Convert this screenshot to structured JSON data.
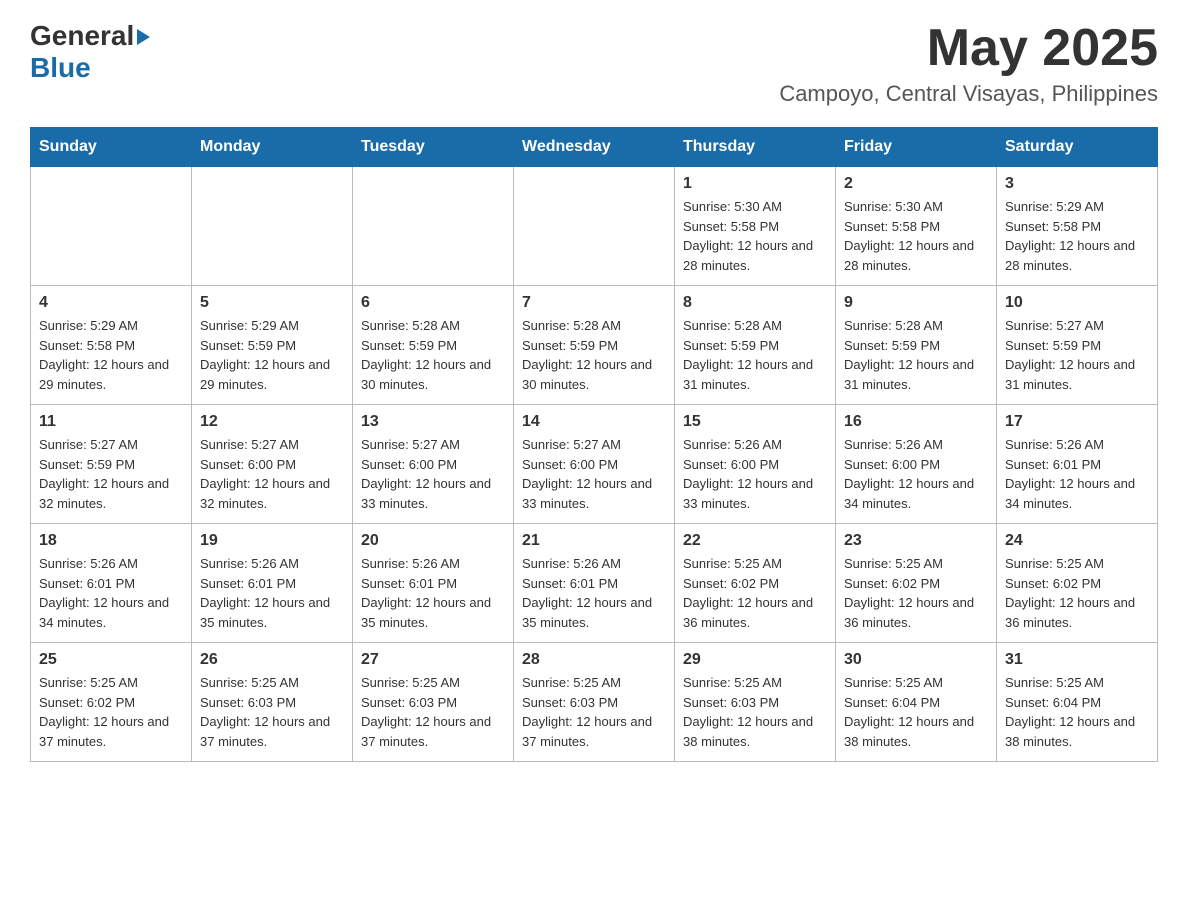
{
  "header": {
    "logo_general": "General",
    "logo_blue": "Blue",
    "month_title": "May 2025",
    "location": "Campoyo, Central Visayas, Philippines"
  },
  "days_of_week": [
    "Sunday",
    "Monday",
    "Tuesday",
    "Wednesday",
    "Thursday",
    "Friday",
    "Saturday"
  ],
  "weeks": [
    {
      "days": [
        {
          "number": "",
          "info": ""
        },
        {
          "number": "",
          "info": ""
        },
        {
          "number": "",
          "info": ""
        },
        {
          "number": "",
          "info": ""
        },
        {
          "number": "1",
          "info": "Sunrise: 5:30 AM\nSunset: 5:58 PM\nDaylight: 12 hours and 28 minutes."
        },
        {
          "number": "2",
          "info": "Sunrise: 5:30 AM\nSunset: 5:58 PM\nDaylight: 12 hours and 28 minutes."
        },
        {
          "number": "3",
          "info": "Sunrise: 5:29 AM\nSunset: 5:58 PM\nDaylight: 12 hours and 28 minutes."
        }
      ]
    },
    {
      "days": [
        {
          "number": "4",
          "info": "Sunrise: 5:29 AM\nSunset: 5:58 PM\nDaylight: 12 hours and 29 minutes."
        },
        {
          "number": "5",
          "info": "Sunrise: 5:29 AM\nSunset: 5:59 PM\nDaylight: 12 hours and 29 minutes."
        },
        {
          "number": "6",
          "info": "Sunrise: 5:28 AM\nSunset: 5:59 PM\nDaylight: 12 hours and 30 minutes."
        },
        {
          "number": "7",
          "info": "Sunrise: 5:28 AM\nSunset: 5:59 PM\nDaylight: 12 hours and 30 minutes."
        },
        {
          "number": "8",
          "info": "Sunrise: 5:28 AM\nSunset: 5:59 PM\nDaylight: 12 hours and 31 minutes."
        },
        {
          "number": "9",
          "info": "Sunrise: 5:28 AM\nSunset: 5:59 PM\nDaylight: 12 hours and 31 minutes."
        },
        {
          "number": "10",
          "info": "Sunrise: 5:27 AM\nSunset: 5:59 PM\nDaylight: 12 hours and 31 minutes."
        }
      ]
    },
    {
      "days": [
        {
          "number": "11",
          "info": "Sunrise: 5:27 AM\nSunset: 5:59 PM\nDaylight: 12 hours and 32 minutes."
        },
        {
          "number": "12",
          "info": "Sunrise: 5:27 AM\nSunset: 6:00 PM\nDaylight: 12 hours and 32 minutes."
        },
        {
          "number": "13",
          "info": "Sunrise: 5:27 AM\nSunset: 6:00 PM\nDaylight: 12 hours and 33 minutes."
        },
        {
          "number": "14",
          "info": "Sunrise: 5:27 AM\nSunset: 6:00 PM\nDaylight: 12 hours and 33 minutes."
        },
        {
          "number": "15",
          "info": "Sunrise: 5:26 AM\nSunset: 6:00 PM\nDaylight: 12 hours and 33 minutes."
        },
        {
          "number": "16",
          "info": "Sunrise: 5:26 AM\nSunset: 6:00 PM\nDaylight: 12 hours and 34 minutes."
        },
        {
          "number": "17",
          "info": "Sunrise: 5:26 AM\nSunset: 6:01 PM\nDaylight: 12 hours and 34 minutes."
        }
      ]
    },
    {
      "days": [
        {
          "number": "18",
          "info": "Sunrise: 5:26 AM\nSunset: 6:01 PM\nDaylight: 12 hours and 34 minutes."
        },
        {
          "number": "19",
          "info": "Sunrise: 5:26 AM\nSunset: 6:01 PM\nDaylight: 12 hours and 35 minutes."
        },
        {
          "number": "20",
          "info": "Sunrise: 5:26 AM\nSunset: 6:01 PM\nDaylight: 12 hours and 35 minutes."
        },
        {
          "number": "21",
          "info": "Sunrise: 5:26 AM\nSunset: 6:01 PM\nDaylight: 12 hours and 35 minutes."
        },
        {
          "number": "22",
          "info": "Sunrise: 5:25 AM\nSunset: 6:02 PM\nDaylight: 12 hours and 36 minutes."
        },
        {
          "number": "23",
          "info": "Sunrise: 5:25 AM\nSunset: 6:02 PM\nDaylight: 12 hours and 36 minutes."
        },
        {
          "number": "24",
          "info": "Sunrise: 5:25 AM\nSunset: 6:02 PM\nDaylight: 12 hours and 36 minutes."
        }
      ]
    },
    {
      "days": [
        {
          "number": "25",
          "info": "Sunrise: 5:25 AM\nSunset: 6:02 PM\nDaylight: 12 hours and 37 minutes."
        },
        {
          "number": "26",
          "info": "Sunrise: 5:25 AM\nSunset: 6:03 PM\nDaylight: 12 hours and 37 minutes."
        },
        {
          "number": "27",
          "info": "Sunrise: 5:25 AM\nSunset: 6:03 PM\nDaylight: 12 hours and 37 minutes."
        },
        {
          "number": "28",
          "info": "Sunrise: 5:25 AM\nSunset: 6:03 PM\nDaylight: 12 hours and 37 minutes."
        },
        {
          "number": "29",
          "info": "Sunrise: 5:25 AM\nSunset: 6:03 PM\nDaylight: 12 hours and 38 minutes."
        },
        {
          "number": "30",
          "info": "Sunrise: 5:25 AM\nSunset: 6:04 PM\nDaylight: 12 hours and 38 minutes."
        },
        {
          "number": "31",
          "info": "Sunrise: 5:25 AM\nSunset: 6:04 PM\nDaylight: 12 hours and 38 minutes."
        }
      ]
    }
  ]
}
